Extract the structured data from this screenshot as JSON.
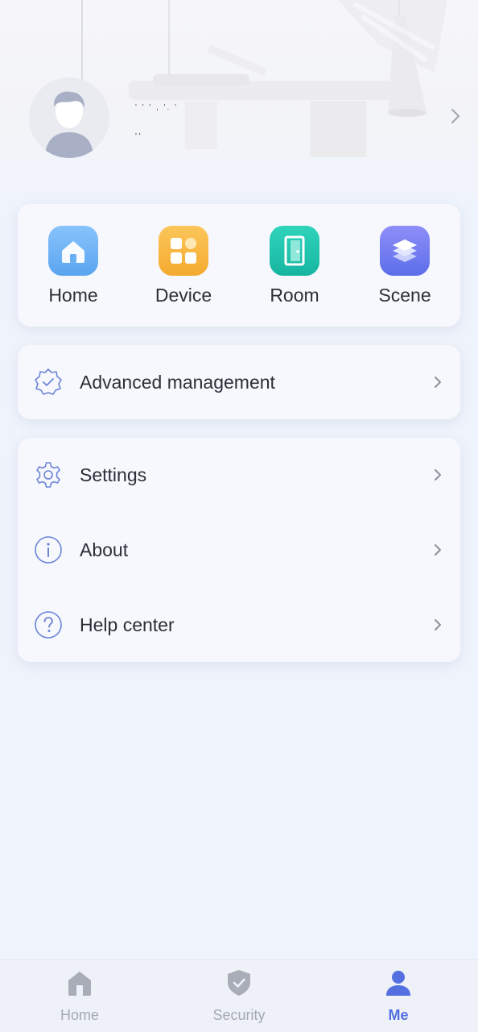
{
  "profile": {
    "name": "' ' ' , '. '",
    "subtitle": "' '"
  },
  "quick_actions": [
    {
      "label": "Home",
      "icon": "house-icon",
      "color": "#6ab1f4"
    },
    {
      "label": "Device",
      "icon": "grid-icon",
      "color": "#f7b740"
    },
    {
      "label": "Room",
      "icon": "door-icon",
      "color": "#22c3ad"
    },
    {
      "label": "Scene",
      "icon": "layers-icon",
      "color": "#6d7cf2"
    }
  ],
  "advanced": {
    "label": "Advanced management",
    "icon": "verified-badge-icon"
  },
  "menu": [
    {
      "label": "Settings",
      "icon": "gear-icon"
    },
    {
      "label": "About",
      "icon": "info-icon"
    },
    {
      "label": "Help center",
      "icon": "question-icon"
    }
  ],
  "tabs": [
    {
      "label": "Home",
      "icon": "home-tab-icon",
      "active": false
    },
    {
      "label": "Security",
      "icon": "shield-check-icon",
      "active": false
    },
    {
      "label": "Me",
      "icon": "person-icon",
      "active": true
    }
  ],
  "colors": {
    "accent": "#5470e0",
    "icon_outline": "#6b84d6",
    "inactive_tab": "#a4a9b4"
  }
}
